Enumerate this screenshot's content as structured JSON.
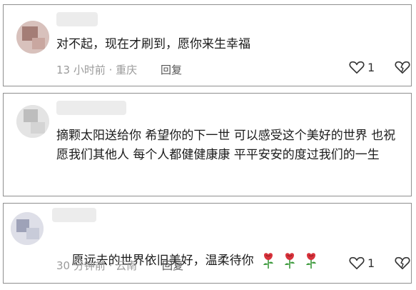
{
  "comments": [
    {
      "text": "对不起，现在才刷到，愿你来生幸福",
      "time": "13 小时前",
      "location": "重庆",
      "reply_label": "回复",
      "like_count": "1",
      "avatar_colors": [
        "#d8c1bc",
        "#a47d76",
        "#c9a7a0"
      ]
    },
    {
      "text": "摘颗太阳送给你 希望你的下一世 可以感受这个美好的世界 也祝愿我们其他人 每个人都健健康康 平平安安的度过我们的一生",
      "avatar_colors": [
        "#e4e4e4",
        "#bdbdbd",
        "#d4d4d4"
      ]
    },
    {
      "text": "愿远去的世界依旧美好，温柔待你",
      "time": "30 分钟前",
      "location": "云南",
      "reply_label": "回复",
      "like_count": "1",
      "emoji": [
        "rose-emoji",
        "rose-emoji",
        "rose-emoji"
      ],
      "avatar_colors": [
        "#dedfe8",
        "#9ea2b8",
        "#c8cbd9"
      ]
    }
  ],
  "colors": {
    "border": "#8f8f8f",
    "meta": "#9b9b9b",
    "rose": "#d8323b",
    "stem": "#3c9a3c"
  }
}
